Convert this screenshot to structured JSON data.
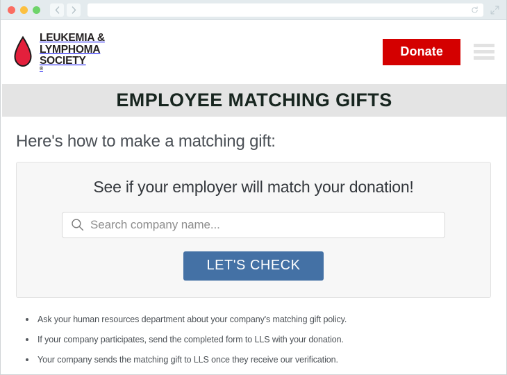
{
  "browser": {
    "traffic_lights": [
      "close",
      "minimize",
      "maximize"
    ],
    "back_icon": "chevron-left-icon",
    "forward_icon": "chevron-right-icon",
    "url_value": "",
    "url_placeholder": "",
    "reload_icon": "reload-icon",
    "expand_icon": "expand-icon"
  },
  "header": {
    "logo": {
      "icon": "blood-drop-icon",
      "line1": "LEUKEMIA &",
      "line2": "LYMPHOMA",
      "line3": "SOCIETY",
      "registered_mark": "®",
      "drop_color": "#e3203c"
    },
    "donate_label": "Donate",
    "donate_color": "#d40000",
    "menu_icon": "hamburger-menu-icon"
  },
  "banner": {
    "title": "EMPLOYEE MATCHING GIFTS",
    "background_color": "#e4e4e4",
    "text_color": "#17251f"
  },
  "main": {
    "lead_heading": "Here's how to make a matching gift:",
    "card": {
      "title": "See if your employer will match your donation!",
      "search_icon": "search-icon",
      "search_value": "",
      "search_placeholder": "Search company name...",
      "submit_label": "LET'S CHECK",
      "submit_color": "#4471a5"
    },
    "steps": [
      "Ask your human resources department about your company's matching gift policy.",
      "If your company participates, send the completed form to LLS with your donation.",
      "Your company sends the matching gift to LLS once they receive our verification."
    ]
  }
}
